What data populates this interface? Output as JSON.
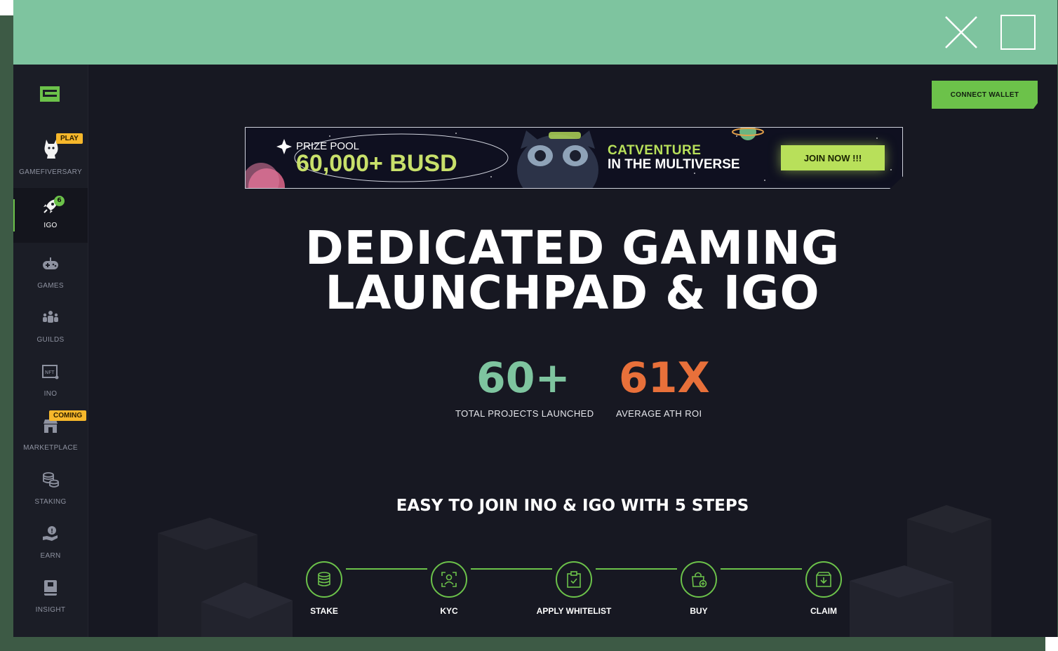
{
  "sidebar": {
    "items": [
      {
        "label": "GAMEFIVERSARY",
        "badge": "PLAY",
        "icon": "cat-mascot-icon"
      },
      {
        "label": "IGO",
        "count": "6",
        "icon": "rocket-icon"
      },
      {
        "label": "GAMES",
        "icon": "gamepad-icon"
      },
      {
        "label": "GUILDS",
        "icon": "guild-icon"
      },
      {
        "label": "INO",
        "icon": "nft-icon"
      },
      {
        "label": "MARKETPLACE",
        "badge": "COMING",
        "icon": "store-icon"
      },
      {
        "label": "STAKING",
        "icon": "coins-icon"
      },
      {
        "label": "EARN",
        "icon": "earn-icon"
      },
      {
        "label": "INSIGHT",
        "icon": "book-icon"
      }
    ]
  },
  "header": {
    "connect_wallet": "CONNECT WALLET"
  },
  "banner": {
    "prize_label": "PRIZE POOL",
    "prize_value": "60,000+ BUSD",
    "title": "CATVENTURE",
    "subtitle": "IN THE MULTIVERSE",
    "cta": "JOIN NOW !!!"
  },
  "hero": {
    "line1": "DEDICATED GAMING",
    "line2": "LAUNCHPAD & IGO"
  },
  "stats": [
    {
      "value": "60+",
      "label": "TOTAL PROJECTS LAUNCHED",
      "color": "#7ec49f"
    },
    {
      "value": "61X",
      "label": "AVERAGE ATH ROI",
      "color": "#e8703a"
    }
  ],
  "steps_title": "EASY TO JOIN INO & IGO WITH 5 STEPS",
  "steps": [
    {
      "label": "STAKE",
      "icon": "coin-stack-icon"
    },
    {
      "label": "KYC",
      "icon": "face-scan-icon"
    },
    {
      "label": "APPLY WHITELIST",
      "icon": "clipboard-check-icon"
    },
    {
      "label": "BUY",
      "icon": "shopping-bag-icon"
    },
    {
      "label": "CLAIM",
      "icon": "download-box-icon"
    }
  ],
  "colors": {
    "accent": "#6cc24a",
    "titlebar": "#7ec49f",
    "badge": "#f6b72b",
    "background": "#171822"
  }
}
